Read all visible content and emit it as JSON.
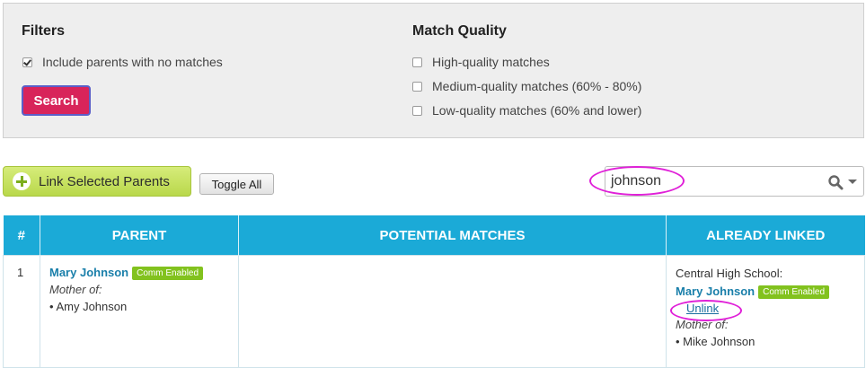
{
  "filters": {
    "title": "Filters",
    "include_no_matches_label": "Include parents with no matches",
    "include_no_matches_checked": true,
    "search_label": "Search"
  },
  "match_quality": {
    "title": "Match Quality",
    "options": [
      {
        "label": "High-quality matches",
        "checked": false
      },
      {
        "label": "Medium-quality matches (60% - 80%)",
        "checked": false
      },
      {
        "label": "Low-quality matches (60% and lower)",
        "checked": false
      }
    ]
  },
  "toolbar": {
    "link_selected_label": "Link Selected Parents",
    "toggle_all_label": "Toggle All",
    "search_value": "johnson",
    "search_icon": "search-icon",
    "dropdown_icon": "caret-down-icon"
  },
  "table": {
    "headers": [
      "#",
      "PARENT",
      "POTENTIAL MATCHES",
      "ALREADY LINKED"
    ],
    "rows": [
      {
        "index": "1",
        "parent": {
          "name": "Mary Johnson",
          "badge": "Comm Enabled",
          "relation": "Mother of:",
          "children": [
            "Amy Johnson"
          ]
        },
        "potential_matches": "",
        "already_linked": {
          "school": "Central High School:",
          "name": "Mary Johnson",
          "badge": "Comm Enabled",
          "unlink_label": "Unlink",
          "relation": "Mother of:",
          "children": [
            "Mike Johnson"
          ]
        }
      }
    ]
  },
  "colors": {
    "accent_blue": "#1baad7",
    "search_button": "#d8245a",
    "badge_green": "#82c21e",
    "link_button": "#c3df5c",
    "highlight": "#e020d8"
  }
}
